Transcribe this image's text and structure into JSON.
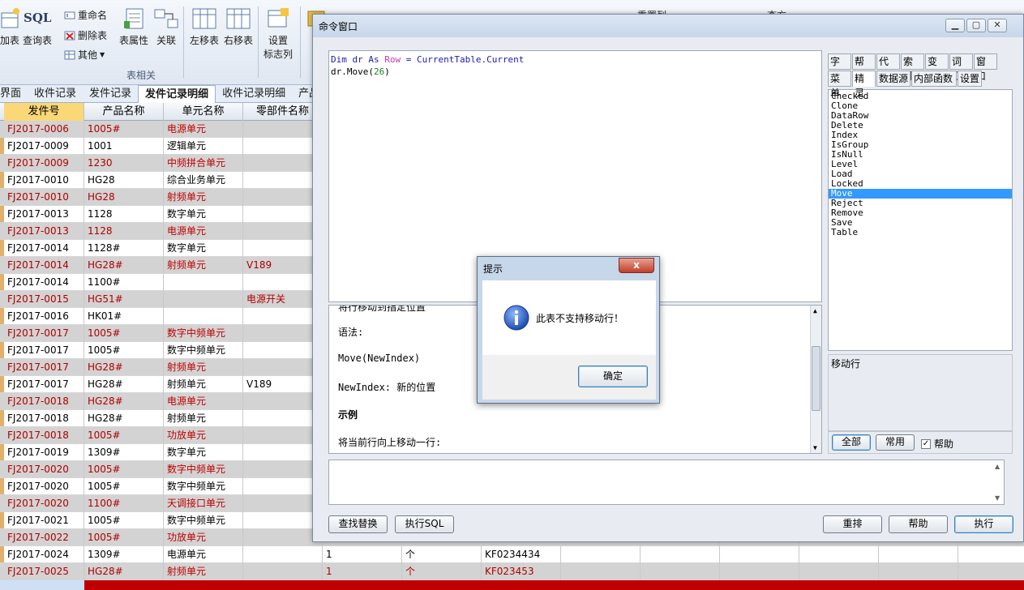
{
  "ribbon": {
    "buttons": [
      {
        "label": "加表",
        "icon": "add-table-icon"
      },
      {
        "label": "查询表",
        "icon": "sql-icon",
        "icon_text": "SQL"
      },
      {
        "label": "表属性",
        "icon": "table-properties-icon"
      },
      {
        "label": "关联",
        "icon": "relation-icon"
      },
      {
        "label": "左移表",
        "icon": "move-left-icon"
      },
      {
        "label": "右移表",
        "icon": "move-right-icon"
      },
      {
        "label": "设置",
        "label2": "标志列",
        "icon": "flag-column-icon"
      }
    ],
    "small_buttons": [
      {
        "label": "重命名",
        "icon": "rename-icon"
      },
      {
        "label": "删除表",
        "icon": "delete-table-icon"
      },
      {
        "label": "其他",
        "icon": "other-icon"
      }
    ],
    "group_label": "表相关",
    "partial_labels": {
      "a": "重置列",
      "b": "查方"
    }
  },
  "tabs": [
    "界面",
    "收件记录",
    "发件记录",
    "发件记录明细",
    "收件记录明细",
    "产品"
  ],
  "active_tab": 3,
  "grid": {
    "headers": [
      "发件号",
      "产品名称",
      "单元名称",
      "零部件名称"
    ],
    "rows": [
      {
        "id": "FJ2017-0006",
        "prod": "1005#",
        "unit": "电源单元",
        "part": "",
        "red": true
      },
      {
        "id": "FJ2017-0009",
        "prod": "1001",
        "unit": "逻辑单元",
        "part": "",
        "red": false
      },
      {
        "id": "FJ2017-0009",
        "prod": "1230",
        "unit": "中频拼合单元",
        "part": "",
        "red": true
      },
      {
        "id": "FJ2017-0010",
        "prod": "HG28",
        "unit": "综合业务单元",
        "part": "",
        "red": false
      },
      {
        "id": "FJ2017-0010",
        "prod": "HG28",
        "unit": "射频单元",
        "part": "",
        "red": true
      },
      {
        "id": "FJ2017-0013",
        "prod": "1128",
        "unit": "数字单元",
        "part": "",
        "red": false
      },
      {
        "id": "FJ2017-0013",
        "prod": "1128",
        "unit": "电源单元",
        "part": "",
        "red": true
      },
      {
        "id": "FJ2017-0014",
        "prod": "1128#",
        "unit": "数字单元",
        "part": "",
        "red": false
      },
      {
        "id": "FJ2017-0014",
        "prod": "HG28#",
        "unit": "射频单元",
        "part": "V189",
        "red": true
      },
      {
        "id": "FJ2017-0014",
        "prod": "1100#",
        "unit": "",
        "part": "",
        "red": false
      },
      {
        "id": "FJ2017-0015",
        "prod": "HG51#",
        "unit": "",
        "part": "电源开关",
        "red": true
      },
      {
        "id": "FJ2017-0016",
        "prod": "HK01#",
        "unit": "",
        "part": "",
        "red": false
      },
      {
        "id": "FJ2017-0017",
        "prod": "1005#",
        "unit": "数字中频单元",
        "part": "",
        "red": true
      },
      {
        "id": "FJ2017-0017",
        "prod": "1005#",
        "unit": "数字中频单元",
        "part": "",
        "red": false
      },
      {
        "id": "FJ2017-0017",
        "prod": "HG28#",
        "unit": "射频单元",
        "part": "",
        "red": true
      },
      {
        "id": "FJ2017-0017",
        "prod": "HG28#",
        "unit": "射频单元",
        "part": "V189",
        "red": false
      },
      {
        "id": "FJ2017-0018",
        "prod": "HG28#",
        "unit": "电源单元",
        "part": "",
        "red": true
      },
      {
        "id": "FJ2017-0018",
        "prod": "HG28#",
        "unit": "射频单元",
        "part": "",
        "red": false
      },
      {
        "id": "FJ2017-0018",
        "prod": "1005#",
        "unit": "功放单元",
        "part": "",
        "red": true
      },
      {
        "id": "FJ2017-0019",
        "prod": "1309#",
        "unit": "数字单元",
        "part": "",
        "red": false
      },
      {
        "id": "FJ2017-0020",
        "prod": "1005#",
        "unit": "数字中频单元",
        "part": "",
        "red": true
      },
      {
        "id": "FJ2017-0020",
        "prod": "1005#",
        "unit": "数字中频单元",
        "part": "",
        "red": false
      },
      {
        "id": "FJ2017-0020",
        "prod": "1100#",
        "unit": "天调接口单元",
        "part": "",
        "red": true
      },
      {
        "id": "FJ2017-0021",
        "prod": "1005#",
        "unit": "数字中频单元",
        "part": "",
        "red": false
      },
      {
        "id": "FJ2017-0022",
        "prod": "1005#",
        "unit": "功放单元",
        "part": "",
        "red": true
      },
      {
        "id": "FJ2017-0024",
        "prod": "1309#",
        "unit": "电源单元",
        "part": "",
        "qty": "1",
        "meas": "个",
        "code": "KF0234434",
        "red": false
      },
      {
        "id": "FJ2017-0025",
        "prod": "HG28#",
        "unit": "射频单元",
        "part": "",
        "qty": "1",
        "meas": "个",
        "code": "KF023453",
        "red": true
      }
    ]
  },
  "cmd": {
    "title": "命令窗口",
    "code_line1": {
      "a": "Dim dr As ",
      "b": "Row",
      "c": " = CurrentTable.Current"
    },
    "code_line2": {
      "a": "dr.Move(",
      "b": "26",
      "c": ")"
    },
    "help": {
      "line0": "将行移动到指定位置",
      "syntax_label": "语法:",
      "syntax": "Move(NewIndex)",
      "param": "NewIndex: 新的位置",
      "example_label": "示例",
      "example": "将当前行向上移动一行:"
    },
    "buttons": {
      "find": "查找替换",
      "sql": "执行SQL",
      "reorder": "重排",
      "help": "帮助",
      "run": "执行"
    },
    "right_tabs_row1": [
      "字段",
      "帮助",
      "代码",
      "索引",
      "变量",
      "词汇",
      "窗口"
    ],
    "right_tabs_row2": [
      "菜单",
      "精灵",
      "数据源",
      "内部函数",
      "设置"
    ],
    "members": [
      "Checked",
      "Clone",
      "DataRow",
      "Delete",
      "Index",
      "IsGroup",
      "IsNull",
      "Level",
      "Load",
      "Locked",
      "Move",
      "Reject",
      "Remove",
      "Save",
      "Table"
    ],
    "selected_member": "Move",
    "description": "移动行",
    "filter": {
      "all": "全部",
      "common": "常用",
      "help_check": "帮助",
      "help_checked": true
    }
  },
  "dialog": {
    "title": "提示",
    "message": "此表不支持移动行！",
    "ok": "确定",
    "close": "x"
  }
}
